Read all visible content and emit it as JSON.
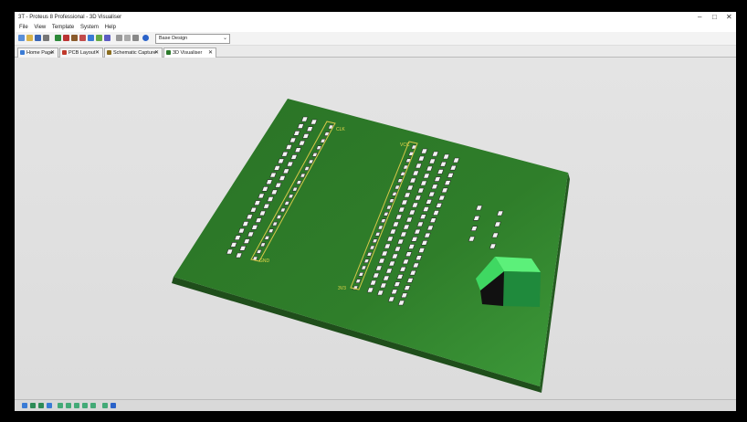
{
  "window": {
    "title": "3T - Proteus 8 Professional - 3D Visualiser",
    "minimize": "–",
    "maximize": "□",
    "close": "✕"
  },
  "menu": [
    "File",
    "View",
    "Template",
    "System",
    "Help"
  ],
  "toolbar": {
    "dropdown_value": "Base Design",
    "dropdown_arrow": "⌄"
  },
  "tabs": [
    {
      "label": "Home Page",
      "close": "✕",
      "icon": "home-icon",
      "color": "#3a7bd5"
    },
    {
      "label": "PCB Layout",
      "close": "✕",
      "icon": "pcb-layout-icon",
      "color": "#c0392b"
    },
    {
      "label": "Schematic Capture",
      "close": "✕",
      "icon": "schematic-icon",
      "color": "#8a6d1f"
    },
    {
      "label": "3D Visualiser",
      "close": "✕",
      "icon": "3d-visualiser-icon",
      "color": "#2c7a2c"
    }
  ],
  "board": {
    "color": "#2e7a28",
    "labels": {
      "clk": "CLK",
      "gnd": "GND",
      "vcc": "VCC",
      "v3": "3V3"
    }
  }
}
